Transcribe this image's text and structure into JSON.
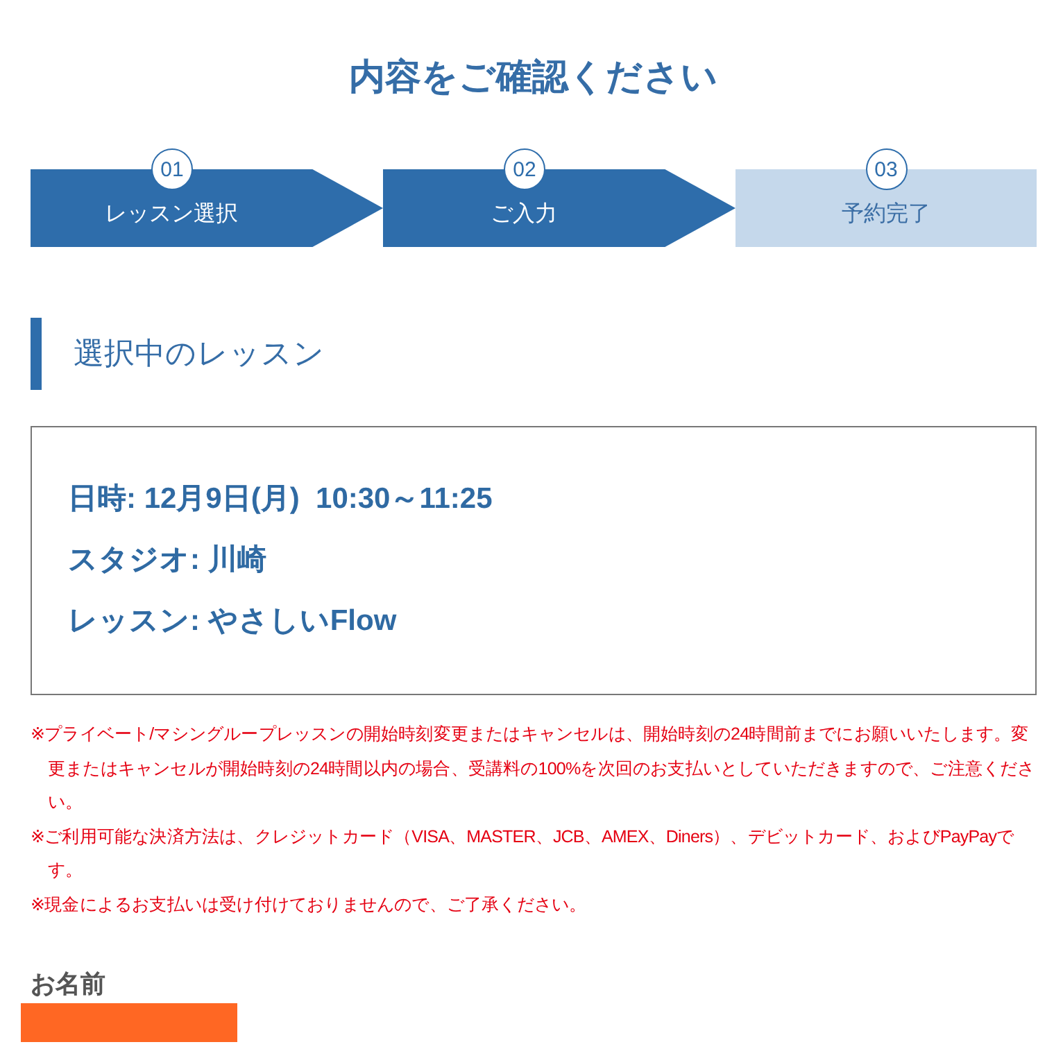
{
  "page_title": "内容をご確認ください",
  "steps": [
    {
      "number": "01",
      "label": "レッスン選択",
      "active": true
    },
    {
      "number": "02",
      "label": "ご入力",
      "active": true
    },
    {
      "number": "03",
      "label": "予約完了",
      "active": false
    }
  ],
  "section": {
    "title": "選択中のレッスン"
  },
  "lesson_details": [
    "日時: 12月9日(月)  10:30～11:25",
    "スタジオ: 川崎",
    "レッスン: やさしいFlow"
  ],
  "notes": [
    "※プライベート/マシングループレッスンの開始時刻変更またはキャンセルは、開始時刻の24時間前までにお願いいたします。変更またはキャンセルが開始時刻の24時間以内の場合、受講料の100%を次回のお支払いとしていただきますので、ご注意ください。",
    "※ご利用可能な決済方法は、クレジットカード（VISA、MASTER、JCB、AMEX、Diners）、デビットカード、およびPayPayです。",
    "※現金によるお支払いは受け付けておりませんので、ご了承ください。"
  ],
  "form": {
    "fields": [
      {
        "label": "お名前",
        "redacted": true
      }
    ]
  }
}
